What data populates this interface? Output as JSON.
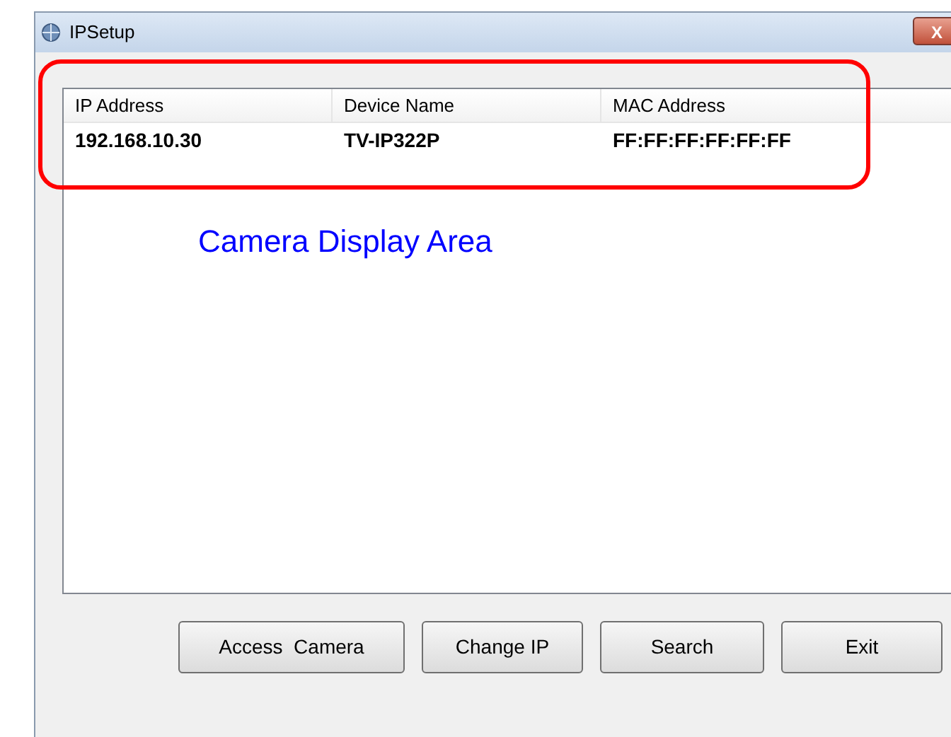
{
  "window": {
    "title": "IPSetup",
    "close": "X"
  },
  "table": {
    "columns": [
      "IP Address",
      "Device Name",
      "MAC Address"
    ],
    "rows": [
      [
        "192.168.10.30",
        "TV-IP322P",
        "FF:FF:FF:FF:FF:FF"
      ]
    ]
  },
  "annotation": {
    "label": "Camera Display Area"
  },
  "buttons": [
    "Access  Camera",
    "Change IP",
    "Search",
    "Exit"
  ]
}
